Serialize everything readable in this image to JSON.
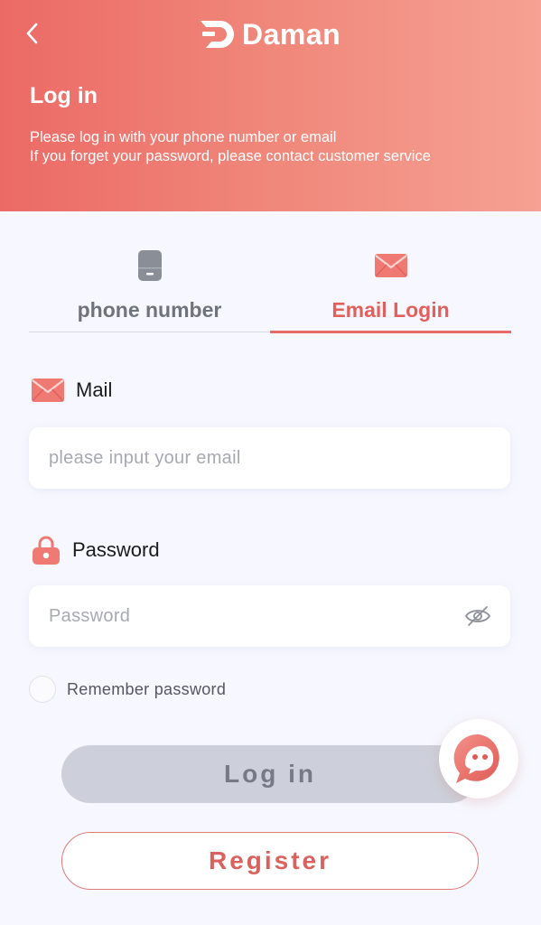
{
  "header": {
    "brand": "Daman",
    "title": "Log in",
    "subtitle_line1": "Please log in with your phone number or email",
    "subtitle_line2": "If you forget your password, please contact customer service"
  },
  "tabs": {
    "phone": {
      "label": "phone number",
      "icon": "phone-icon",
      "active": false
    },
    "email": {
      "label": "Email Login",
      "icon": "envelope-icon",
      "active": true
    }
  },
  "mail": {
    "label": "Mail",
    "placeholder": "please input your email",
    "value": ""
  },
  "password": {
    "label": "Password",
    "placeholder": "Password",
    "value": ""
  },
  "remember": {
    "label": "Remember password",
    "checked": false
  },
  "buttons": {
    "login": "Log in",
    "register": "Register"
  },
  "colors": {
    "accent": "#e86a66",
    "header_start": "#ec6a66",
    "header_end": "#f6a193",
    "login_disabled_bg": "#cdd0da"
  }
}
